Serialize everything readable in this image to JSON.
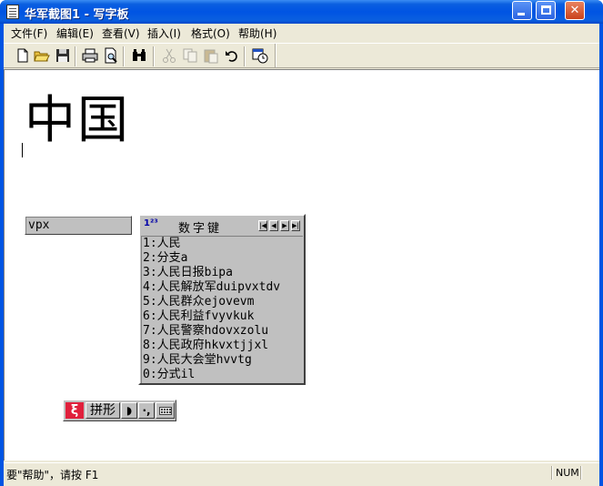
{
  "window": {
    "title": "华军截图1 - 写字板",
    "controls": {
      "minimize": "_",
      "maximize": "□",
      "close": "✕"
    }
  },
  "menu": {
    "items": [
      {
        "label": "文件(F)"
      },
      {
        "label": "编辑(E)"
      },
      {
        "label": "查看(V)"
      },
      {
        "label": "插入(I)"
      },
      {
        "label": "格式(O)"
      },
      {
        "label": "帮助(H)"
      }
    ]
  },
  "toolbar": {
    "icons": [
      "new-document-icon",
      "open-folder-icon",
      "save-disk-icon",
      "print-icon",
      "print-preview-icon",
      "find-binoculars-icon",
      "cut-scissors-icon",
      "copy-icon",
      "paste-icon",
      "undo-icon",
      "insert-datetime-icon"
    ]
  },
  "document": {
    "text": "中国"
  },
  "ime": {
    "composition": "vpx",
    "candidate_title": "数字键",
    "candidate_icon": "1²³",
    "candidates": [
      "1:人民",
      "2:分支a",
      "3:人民日报bipa",
      "4:人民解放军duipvxtdv",
      "5:人民群众ejovevm",
      "6:人民利益fvyvkuk",
      "7:人民警察hdovxzolu",
      "8:人民政府hkvxtjjxl",
      "9:人民大会堂hvvtg",
      "0:分式il"
    ],
    "nav_buttons": [
      "|◀",
      "◀",
      "▶",
      "▶|"
    ],
    "toolbar": {
      "logo": "ξ",
      "name": "拼形",
      "moon": "◗",
      "punct": "·,"
    }
  },
  "status": {
    "help_text": "要\"帮助\"，请按 F1",
    "num": "NUM"
  },
  "colors": {
    "title_blue": "#0054e3",
    "face": "#ece9d8",
    "ime_face": "#c0c0c0",
    "ime_logo": "#e0203c"
  }
}
